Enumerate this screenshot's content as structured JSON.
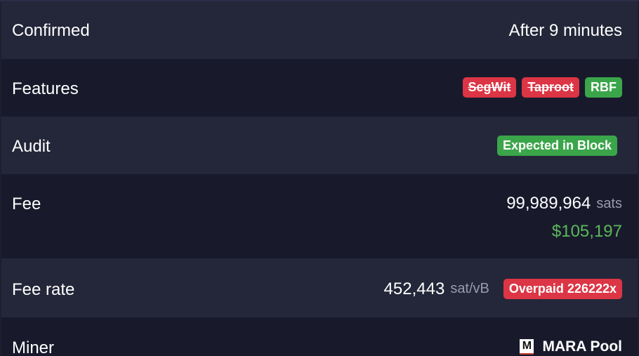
{
  "rows": {
    "confirmed": {
      "label": "Confirmed",
      "value": "After 9 minutes"
    },
    "features": {
      "label": "Features",
      "badges": [
        "SegWit",
        "Taproot",
        "RBF"
      ]
    },
    "audit": {
      "label": "Audit",
      "badge": "Expected in Block"
    },
    "fee": {
      "label": "Fee",
      "amount": "99,989,964",
      "unit": "sats",
      "fiat": "$105,197"
    },
    "fee_rate": {
      "label": "Fee rate",
      "amount": "452,443",
      "unit": "sat/vB",
      "badge": "Overpaid 226222x"
    },
    "miner": {
      "label": "Miner",
      "name": "MARA Pool",
      "logo_letter": "M"
    }
  },
  "colors": {
    "background": "#1d1f31",
    "row_alt": "#181a2b",
    "badge_red": "#dc3545",
    "badge_green": "#3ba54a",
    "fiat_green": "#5cb85c"
  }
}
